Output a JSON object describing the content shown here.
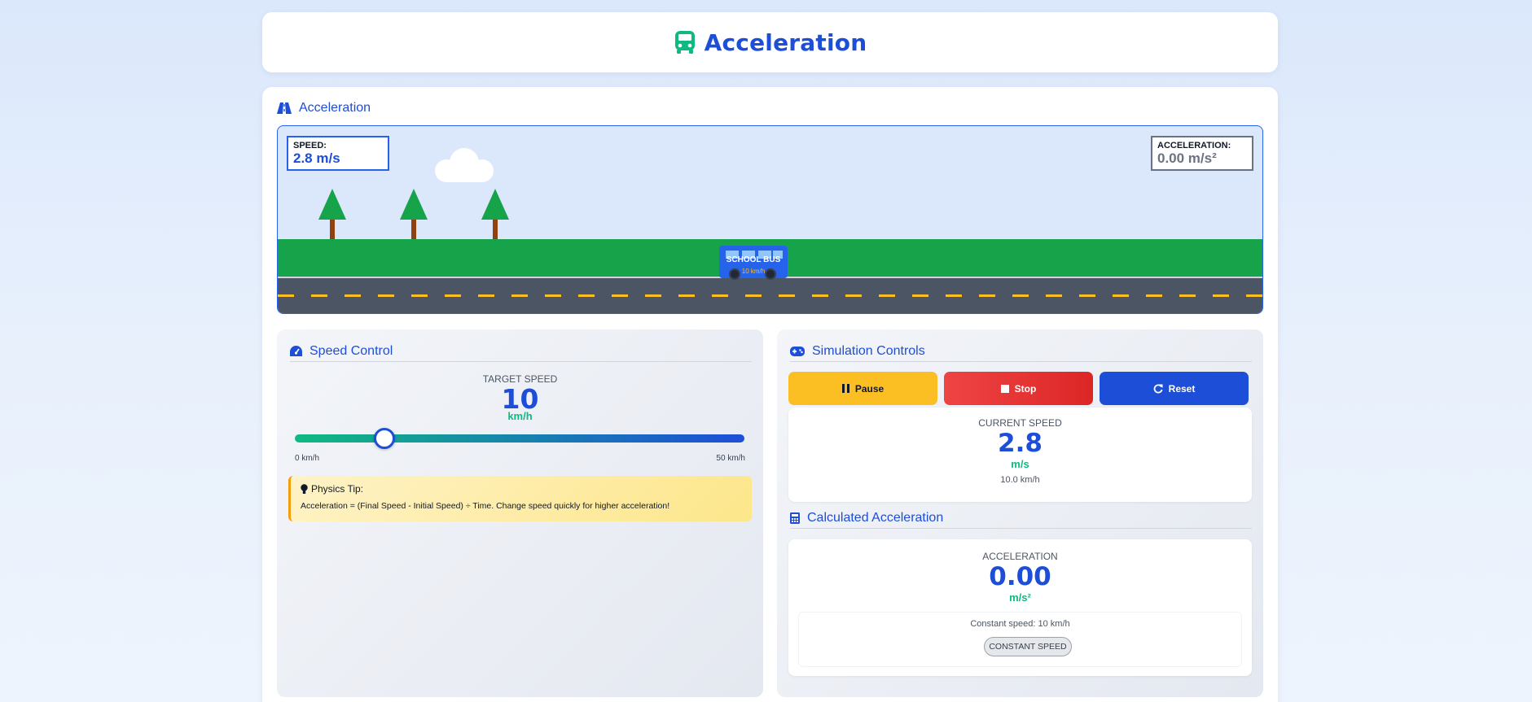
{
  "header": {
    "title": "Acceleration",
    "icon": "bus-icon"
  },
  "scene": {
    "title": "Acceleration",
    "icon": "road-icon",
    "hud_speed_label": "SPEED:",
    "hud_speed_value": "2.8 m/s",
    "hud_accel_label": "ACCELERATION:",
    "hud_accel_value": "0.00 m/s²",
    "bus_label": "SCHOOL BUS",
    "bus_speed": "10 km/h"
  },
  "speed_control": {
    "title": "Speed Control",
    "icon": "gauge-icon",
    "target_label": "TARGET SPEED",
    "target_value": "10",
    "target_unit": "km/h",
    "slider_fraction": 0.2,
    "range_min": "0 km/h",
    "range_max": "50 km/h",
    "tip_title": "Physics Tip:",
    "tip_icon": "lightbulb-icon",
    "tip_text": "Acceleration = (Final Speed - Initial Speed) ÷ Time. Change speed quickly for higher acceleration!"
  },
  "simulation": {
    "title": "Simulation Controls",
    "icon": "gamepad-icon",
    "pause_label": "Pause",
    "stop_label": "Stop",
    "reset_label": "Reset",
    "current_speed_label": "CURRENT SPEED",
    "current_speed_value": "2.8",
    "current_speed_unit": "m/s",
    "current_speed_kmh": "10.0 km/h"
  },
  "calculated": {
    "title": "Calculated Acceleration",
    "icon": "calculator-icon",
    "label": "ACCELERATION",
    "value": "0.00",
    "unit": "m/s²",
    "note": "Constant speed: 10 km/h",
    "badge": "CONSTANT SPEED"
  },
  "colors": {
    "primary": "#1d4ed8",
    "accent": "#10b981",
    "pause": "#fbbf24",
    "stop": "#ef4444",
    "grass": "#16a34a",
    "road": "#4b5563"
  }
}
